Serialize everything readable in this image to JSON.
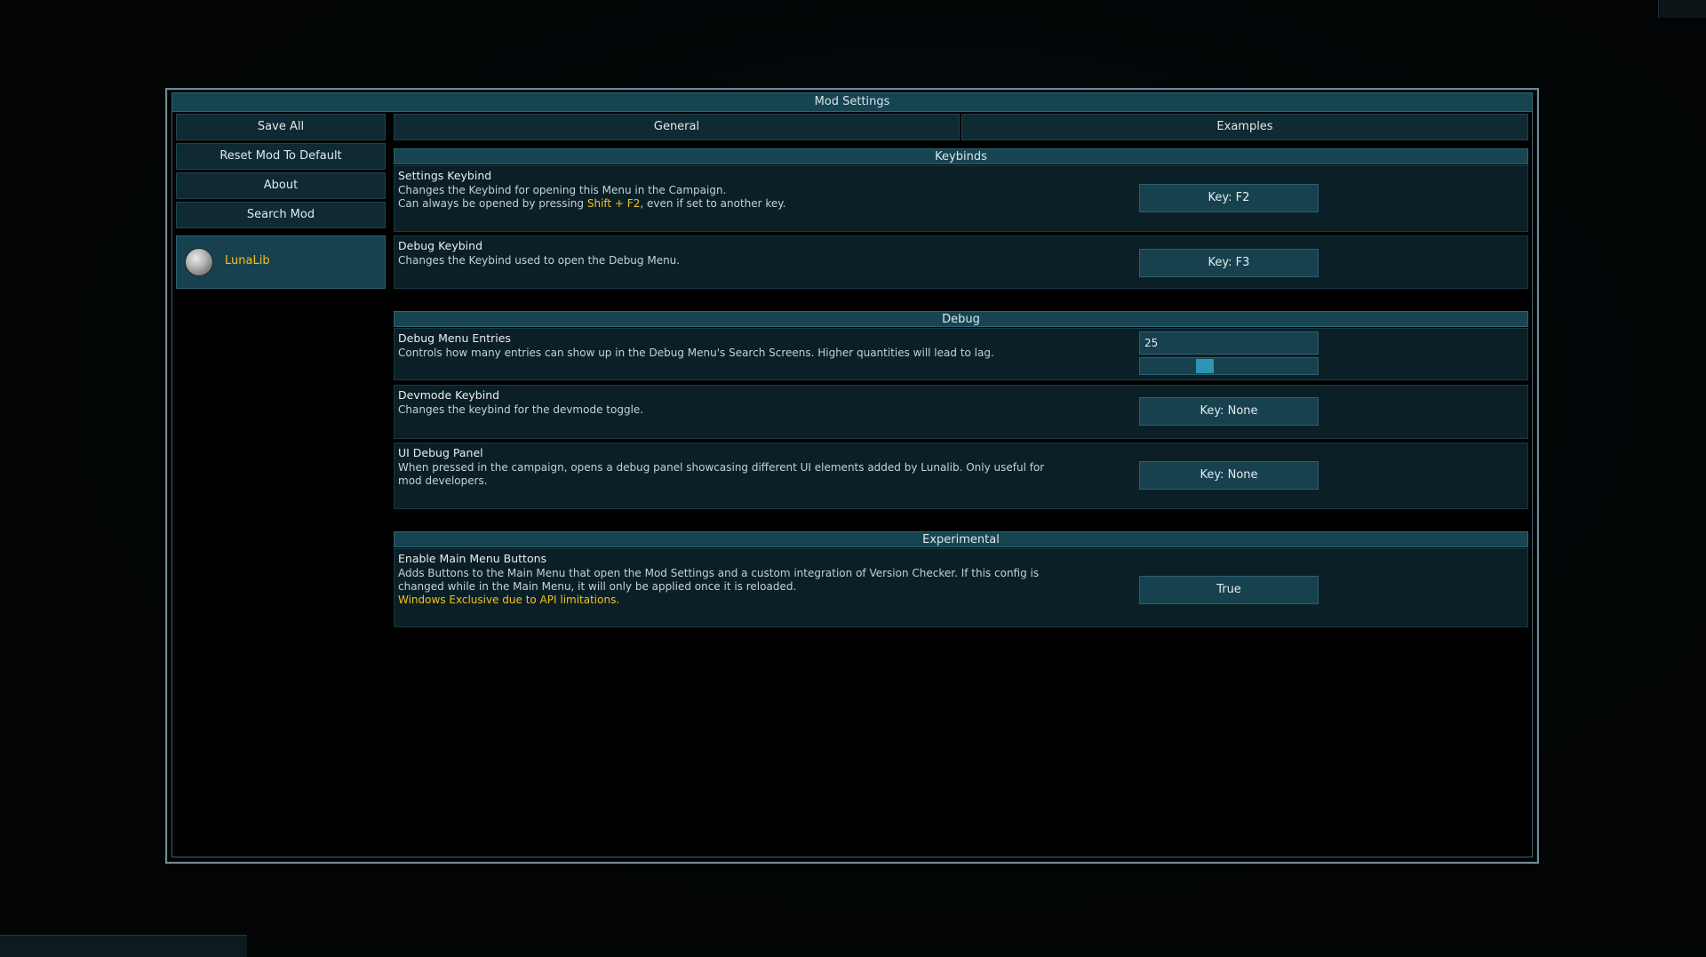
{
  "window": {
    "title": "Mod Settings"
  },
  "sidebar": {
    "buttons": [
      {
        "label": "Save All"
      },
      {
        "label": "Reset Mod To Default"
      },
      {
        "label": "About"
      },
      {
        "label": "Search Mod"
      }
    ],
    "mods": [
      {
        "name": "LunaLib",
        "icon": "planet-icon",
        "selected": true
      }
    ]
  },
  "tabs": [
    {
      "label": "General",
      "active": true
    },
    {
      "label": "Examples",
      "active": false
    }
  ],
  "sections": {
    "keybinds": {
      "header": "Keybinds",
      "settings_keybind": {
        "title": "Settings Keybind",
        "desc_line1": "Changes the Keybind for opening this Menu in the Campaign.",
        "desc_line2_pre": "Can always be opened by pressing ",
        "desc_line2_hl": "Shift + F2",
        "desc_line2_post": ", even if set to another key.",
        "button": "Key: F2"
      },
      "debug_keybind": {
        "title": "Debug Keybind",
        "desc": "Changes the Keybind used to open the Debug Menu.",
        "button": "Key: F3"
      }
    },
    "debug": {
      "header": "Debug",
      "debug_menu_entries": {
        "title": "Debug Menu Entries",
        "desc": "Controls how many entries can show up in the Debug Menu's Search Screens. Higher quantities will lead to lag.",
        "value": "25",
        "slider_fraction": 0.35
      },
      "devmode_keybind": {
        "title": "Devmode Keybind",
        "desc": "Changes the keybind for the devmode toggle.",
        "button": "Key: None"
      },
      "ui_debug_panel": {
        "title": "UI Debug Panel",
        "desc": "When pressed in the campaign, opens a debug panel showcasing different UI elements added by Lunalib. Only useful for mod developers.",
        "button": "Key: None"
      }
    },
    "experimental": {
      "header": "Experimental",
      "enable_main_menu_buttons": {
        "title": "Enable Main Menu Buttons",
        "desc": "Adds Buttons to the Main Menu that open the Mod Settings and a custom integration of Version Checker. If this config is changed while in the Main Menu, it will only be applied once it is reloaded.",
        "warning": "Windows Exclusive due to API limitations.",
        "button": "True"
      }
    }
  },
  "colors": {
    "accent": "#f2c21e",
    "panel": "#0b1f26",
    "header": "#174451",
    "border": "#6e8a94"
  }
}
